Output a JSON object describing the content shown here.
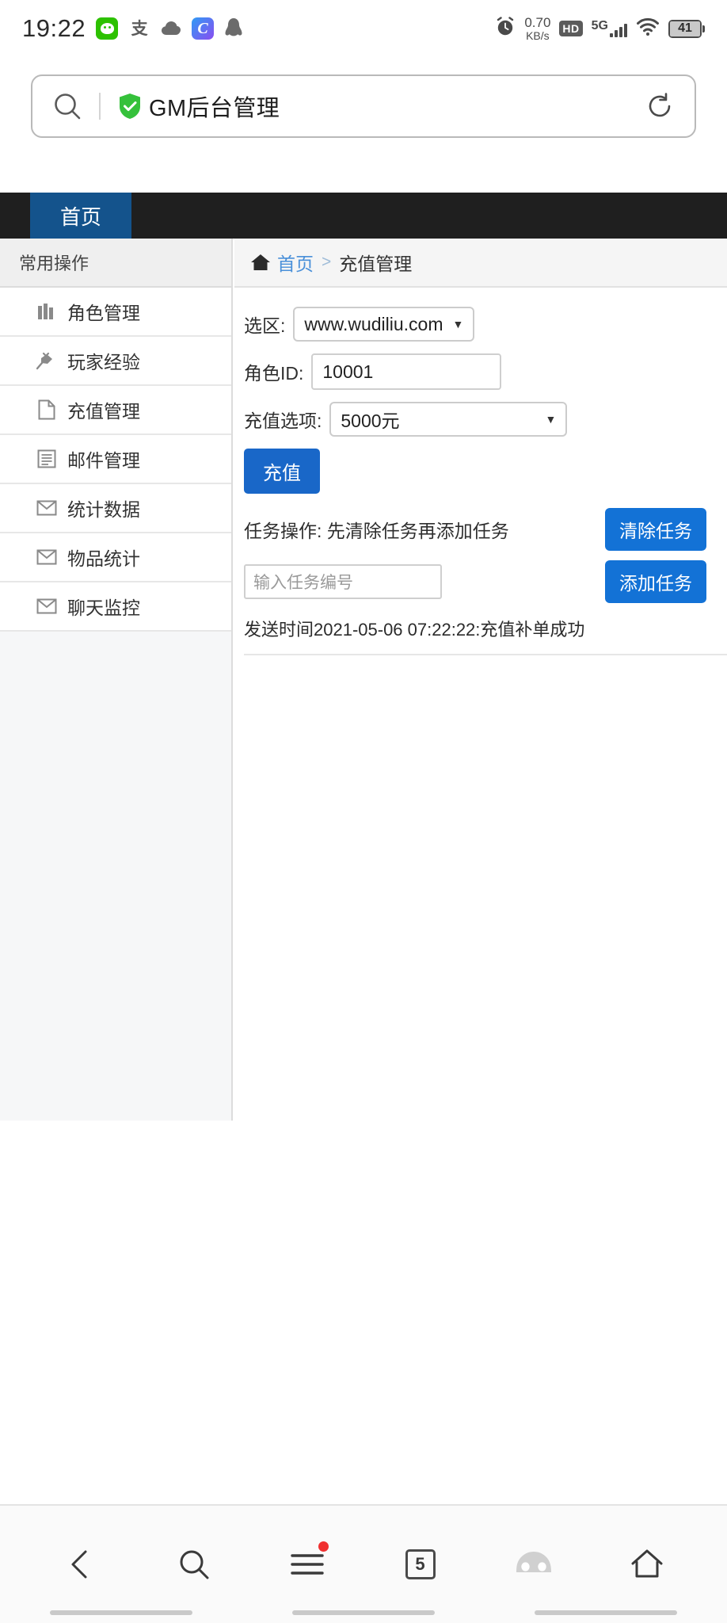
{
  "status_bar": {
    "time": "19:22",
    "net_speed_value": "0.70",
    "net_speed_unit": "KB/s",
    "hd_label": "HD",
    "network_type": "5G",
    "battery_level": "41",
    "app_icons": [
      "wechat-icon",
      "alipay-icon",
      "cloud-icon",
      "c-app-icon",
      "qq-icon"
    ]
  },
  "browser": {
    "search_icon": "search-icon",
    "secure_icon": "shield-check-icon",
    "page_title": "GM后台管理",
    "refresh_icon": "refresh-icon",
    "bottom_nav": {
      "back_label": "back-icon",
      "search_label": "search-icon",
      "menu_label": "menu-icon",
      "tab_count": "5",
      "profile_label": "profile-icon",
      "home_label": "home-icon"
    }
  },
  "topnav": {
    "active_tab": "首页"
  },
  "sidebar": {
    "header": "常用操作",
    "items": [
      {
        "label": "角色管理",
        "icon": "books-icon"
      },
      {
        "label": "玩家经验",
        "icon": "plug-icon"
      },
      {
        "label": "充值管理",
        "icon": "file-icon"
      },
      {
        "label": "邮件管理",
        "icon": "list-icon"
      },
      {
        "label": "统计数据",
        "icon": "envelope-icon"
      },
      {
        "label": "物品统计",
        "icon": "envelope-icon"
      },
      {
        "label": "聊天监控",
        "icon": "envelope-icon"
      }
    ]
  },
  "breadcrumb": {
    "home_icon": "home-icon",
    "home": "首页",
    "separator": ">",
    "current": "充值管理"
  },
  "form": {
    "zone_label": "选区:",
    "zone_value": "www.wudiliu.com",
    "role_id_label": "角色ID:",
    "role_id_value": "10001",
    "recharge_option_label": "充值选项:",
    "recharge_option_value": "5000元",
    "recharge_button": "充值",
    "task_operation_label": "任务操作: 先清除任务再添加任务",
    "clear_task_button": "清除任务",
    "add_task_button": "添加任务",
    "task_input_placeholder": "输入任务编号",
    "task_input_value": "",
    "status_message": "发送时间2021-05-06 07:22:22:充值补单成功"
  },
  "colors": {
    "accent_blue": "#1967c8",
    "nav_dark": "#1f1f1f",
    "tab_blue": "#14538c",
    "link_blue": "#4a90d9",
    "secure_green": "#2dc100"
  }
}
